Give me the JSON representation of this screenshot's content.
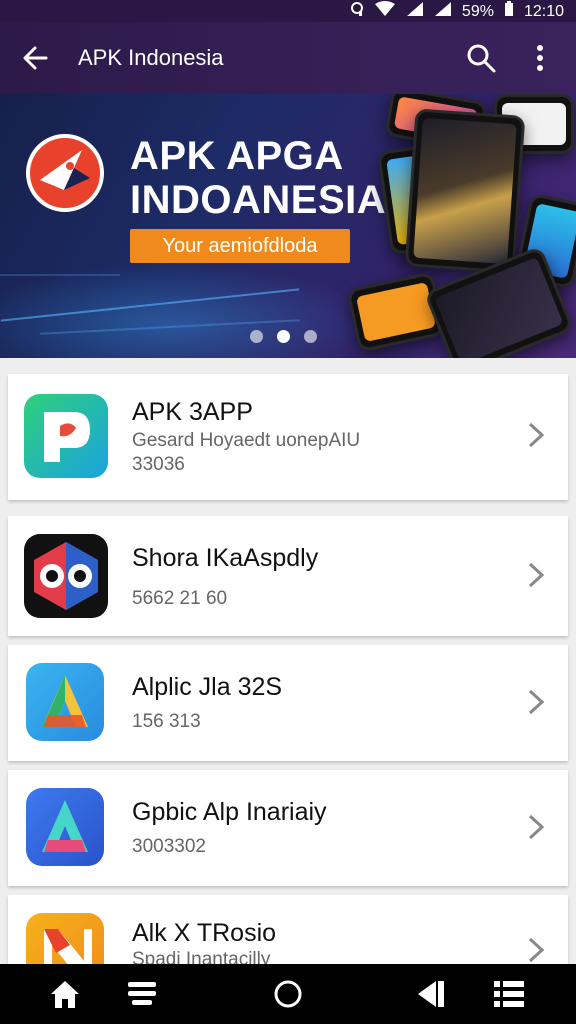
{
  "status_bar": {
    "battery": "59%",
    "time": "12:10"
  },
  "app_bar": {
    "title": "APK Indonesia",
    "back_icon": "arrow-left-icon",
    "search_icon": "search-icon",
    "more_icon": "more-vertical-icon"
  },
  "banner": {
    "headline_line1": "APK APGA",
    "headline_line2": "INDOANESIA",
    "cta_text": "Your aemiofdloda",
    "carousel_pages": 3,
    "carousel_active": 2
  },
  "apps": [
    {
      "name": "APK 3APP",
      "subtitle": "Gesard Hoyaedt uonepAIU",
      "meta": "33036",
      "icon": "p-app-icon"
    },
    {
      "name": "Shora IKaAspdly",
      "subtitle": "",
      "meta": "5662 21 60",
      "icon": "owl-app-icon"
    },
    {
      "name": "Alplic Jla 32S",
      "subtitle": "",
      "meta": "156 313",
      "icon": "a-app-icon"
    },
    {
      "name": "Gpbic Alp Inariaiy",
      "subtitle": "",
      "meta": "3003302",
      "icon": "a-gradient-app-icon"
    },
    {
      "name": "Alk X TRosio",
      "subtitle": "Spadi Inantacilly",
      "meta": "",
      "icon": "n-app-icon"
    }
  ],
  "colors": {
    "app_bar": "#352056",
    "cta": "#f08a1c",
    "logo": "#e8412c"
  }
}
